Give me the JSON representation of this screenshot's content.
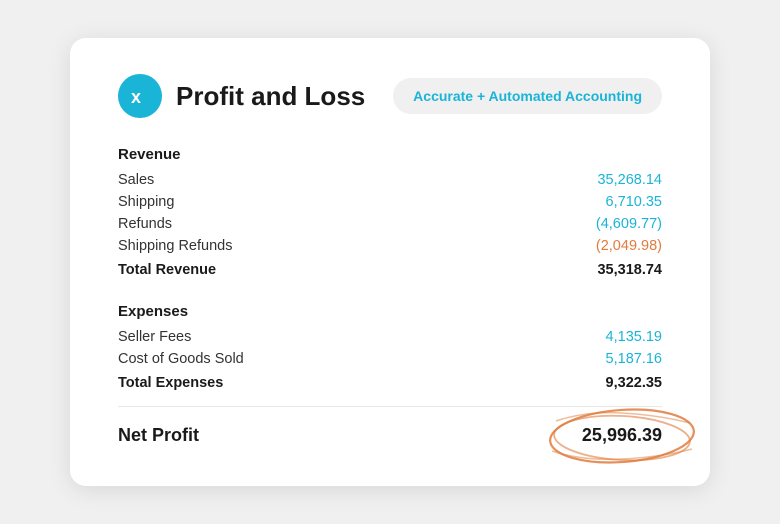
{
  "card": {
    "title": "Profit and Loss",
    "badge": "Accurate + Automated Accounting",
    "logo_alt": "Xero logo"
  },
  "revenue": {
    "label": "Revenue",
    "rows": [
      {
        "name": "Sales",
        "amount": "35,268.14",
        "negative": false
      },
      {
        "name": "Shipping",
        "amount": "6,710.35",
        "negative": false
      },
      {
        "name": "Refunds",
        "amount": "(4,609.77)",
        "negative": false
      },
      {
        "name": "Shipping Refunds",
        "amount": "(2,049.98)",
        "negative": true
      }
    ],
    "total_label": "Total Revenue",
    "total_amount": "35,318.74"
  },
  "expenses": {
    "label": "Expenses",
    "rows": [
      {
        "name": "Seller Fees",
        "amount": "4,135.19",
        "negative": false
      },
      {
        "name": "Cost of Goods Sold",
        "amount": "5,187.16",
        "negative": false
      }
    ],
    "total_label": "Total Expenses",
    "total_amount": "9,322.35"
  },
  "net_profit": {
    "label": "Net Profit",
    "amount": "25,996.39"
  }
}
